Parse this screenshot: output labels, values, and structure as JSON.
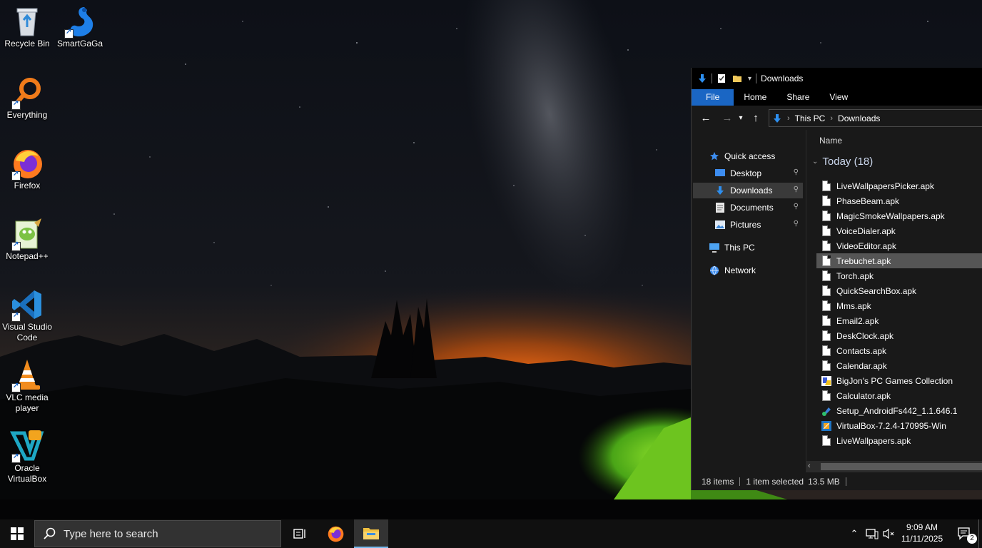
{
  "desktop": {
    "icons": [
      {
        "label": "Recycle Bin",
        "icon": "recycle-bin-icon"
      },
      {
        "label": "SmartGaGa",
        "icon": "smartgaga-icon"
      },
      {
        "label": "Everything",
        "icon": "everything-search-icon"
      },
      {
        "label": "Firefox",
        "icon": "firefox-icon"
      },
      {
        "label": "Notepad++",
        "icon": "notepadpp-icon"
      },
      {
        "label": "Visual Studio Code",
        "icon": "vscode-icon"
      },
      {
        "label": "VLC media player",
        "icon": "vlc-cone-icon"
      },
      {
        "label": "Oracle VirtualBox",
        "icon": "virtualbox-icon"
      }
    ]
  },
  "explorer": {
    "title": "Downloads",
    "ribbon_tabs": [
      "File",
      "Home",
      "Share",
      "View"
    ],
    "active_tab": "File",
    "address": {
      "crumbs": [
        "This PC",
        "Downloads"
      ]
    },
    "nav": {
      "quick_access": "Quick access",
      "items": [
        "Desktop",
        "Downloads",
        "Documents",
        "Pictures"
      ],
      "selected": "Downloads",
      "this_pc": "This PC",
      "network": "Network"
    },
    "column_header": "Name",
    "group_label": "Today (18)",
    "files": [
      {
        "name": "LiveWallpapersPicker.apk",
        "icon": "document-icon"
      },
      {
        "name": "PhaseBeam.apk",
        "icon": "document-icon"
      },
      {
        "name": "MagicSmokeWallpapers.apk",
        "icon": "document-icon"
      },
      {
        "name": "VoiceDialer.apk",
        "icon": "document-icon"
      },
      {
        "name": "VideoEditor.apk",
        "icon": "document-icon"
      },
      {
        "name": "Trebuchet.apk",
        "icon": "document-icon"
      },
      {
        "name": "Torch.apk",
        "icon": "document-icon"
      },
      {
        "name": "QuickSearchBox.apk",
        "icon": "document-icon"
      },
      {
        "name": "Mms.apk",
        "icon": "document-icon"
      },
      {
        "name": "Email2.apk",
        "icon": "document-icon"
      },
      {
        "name": "DeskClock.apk",
        "icon": "document-icon"
      },
      {
        "name": "Contacts.apk",
        "icon": "document-icon"
      },
      {
        "name": "Calendar.apk",
        "icon": "document-icon"
      },
      {
        "name": "BigJon's PC Games Collection",
        "icon": "installer-icon"
      },
      {
        "name": "Calculator.apk",
        "icon": "document-icon"
      },
      {
        "name": "Setup_AndroidFs442_1.1.646.1",
        "icon": "setup-icon"
      },
      {
        "name": "VirtualBox-7.2.4-170995-Win",
        "icon": "virtualbox-installer-icon"
      },
      {
        "name": "LiveWallpapers.apk",
        "icon": "document-icon"
      }
    ],
    "selected_file": "Trebuchet.apk",
    "status": {
      "items": "18 items",
      "selected": "1 item selected",
      "size": "13.5 MB"
    }
  },
  "taskbar": {
    "search_placeholder": "Type here to search",
    "time": "9:09 AM",
    "date": "11/11/2025",
    "notification_count": "2"
  },
  "colors": {
    "accent": "#1a66c4",
    "selection": "#555555",
    "taskbar": "#101010"
  }
}
